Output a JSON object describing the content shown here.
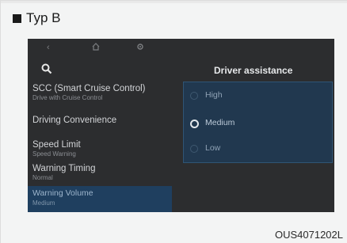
{
  "heading": {
    "text": "Typ B"
  },
  "screen": {
    "nav": {
      "back_icon": "back-arrow-icon",
      "home_icon": "home-icon",
      "settings_icon": "settings-gear-icon"
    },
    "search_icon": "search-icon",
    "menu": [
      {
        "title": "SCC (Smart Cruise Control)",
        "subtitle": "Drive with Cruise Control"
      },
      {
        "title": "Driving Convenience",
        "subtitle": ""
      },
      {
        "title": "Speed Limit",
        "subtitle": "Speed Warning"
      },
      {
        "title": "Warning Timing",
        "subtitle": "Normal"
      }
    ],
    "selected_menu": {
      "title": "Warning Volume",
      "subtitle": "Medium"
    },
    "panel": {
      "title": "Driver assistance",
      "options": [
        "High",
        "Medium",
        "Low"
      ],
      "selected": "Medium"
    }
  },
  "figure_code": "OUS4071202L",
  "colors": {
    "screen_bg": "#2c2d2f",
    "panel_bg": "#21384f",
    "highlight": "#1f3f5f"
  }
}
